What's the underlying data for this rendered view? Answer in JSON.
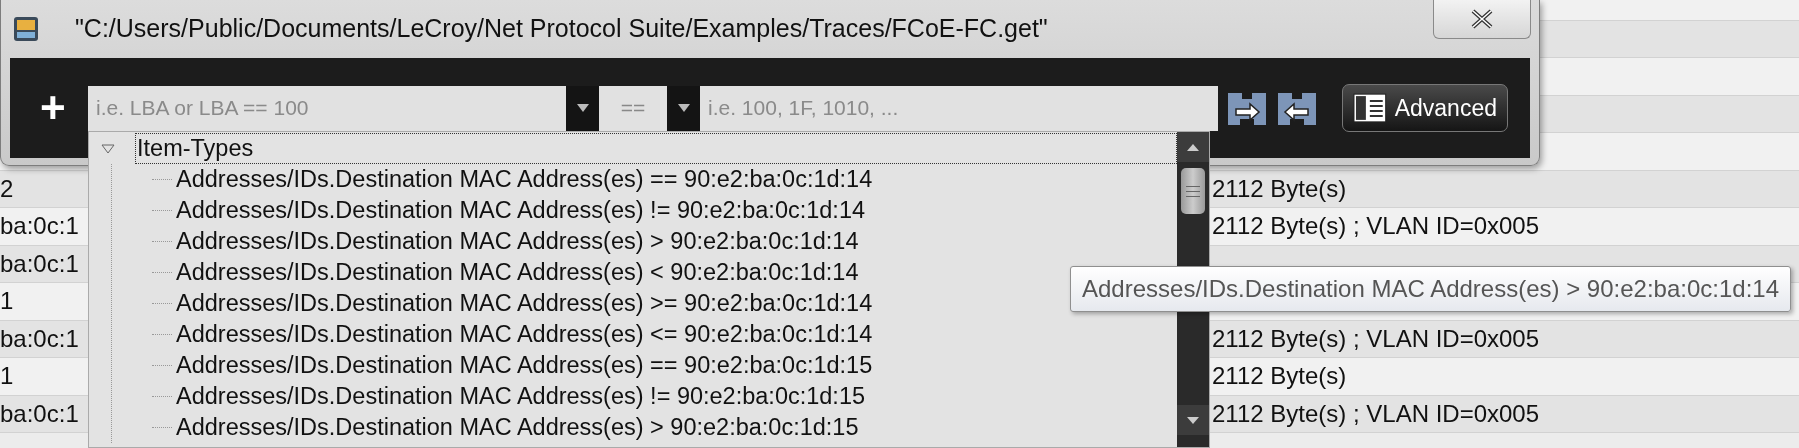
{
  "window": {
    "title": "\"C:/Users/Public/Documents/LeCroy/Net Protocol Suite/Examples/Traces/FCoE-FC.get\""
  },
  "filter_bar": {
    "add_label": "+",
    "field_placeholder": "i.e. LBA or LBA == 100",
    "operator": "==",
    "value_placeholder": "i.e. 100, 1F, 1010, ...",
    "advanced_label": "Advanced"
  },
  "dropdown": {
    "tree": [
      {
        "label": "Item-Types",
        "expanded": true,
        "selected": true,
        "children": [
          {
            "label": "Addresses/IDs.Destination MAC Address(es) == 90:e2:ba:0c:1d:14",
            "selected": false
          },
          {
            "label": "Addresses/IDs.Destination MAC Address(es) != 90:e2:ba:0c:1d:14",
            "selected": false
          },
          {
            "label": "Addresses/IDs.Destination MAC Address(es) > 90:e2:ba:0c:1d:14",
            "selected": false
          },
          {
            "label": "Addresses/IDs.Destination MAC Address(es) < 90:e2:ba:0c:1d:14",
            "selected": false
          },
          {
            "label": "Addresses/IDs.Destination MAC Address(es) >= 90:e2:ba:0c:1d:14",
            "selected": false
          },
          {
            "label": "Addresses/IDs.Destination MAC Address(es) <= 90:e2:ba:0c:1d:14",
            "selected": false
          },
          {
            "label": "Addresses/IDs.Destination MAC Address(es) == 90:e2:ba:0c:1d:15",
            "selected": false
          },
          {
            "label": "Addresses/IDs.Destination MAC Address(es) != 90:e2:ba:0c:1d:15",
            "selected": false
          },
          {
            "label": "Addresses/IDs.Destination MAC Address(es) > 90:e2:ba:0c:1d:15",
            "selected": false
          }
        ]
      }
    ]
  },
  "tooltip": {
    "text": "Addresses/IDs.Destination MAC Address(es) > 90:e2:ba:0c:1d:14"
  },
  "background_rows": [
    {
      "column_1": "2",
      "column_2": "2112 Byte(s)"
    },
    {
      "column_1": "ba:0c:1",
      "column_2": "2112 Byte(s) ; VLAN ID=0x005"
    },
    {
      "column_1": "ba:0c:1"
    },
    {
      "column_1": "1"
    },
    {
      "column_1": "ba:0c:1",
      "column_2": "2112 Byte(s) ; VLAN ID=0x005"
    },
    {
      "column_1": "1",
      "column_2": "2112 Byte(s)"
    },
    {
      "column_1": "ba:0c:1",
      "column_2": "2112 Byte(s) ; VLAN ID=0x005"
    }
  ]
}
